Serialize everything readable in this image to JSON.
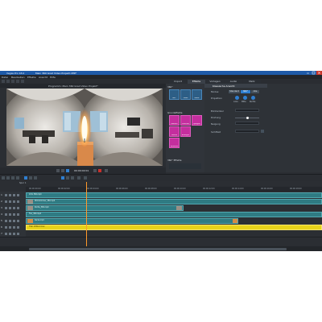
{
  "window": {
    "app_label": "Vegas Pro 18.0",
    "caption": "Mein 360 Grad Video Projekt.VPR*"
  },
  "menubar": {
    "items": [
      "Datei",
      "Bearbeiten",
      "Effekte",
      "Ansicht",
      "Hilfe"
    ]
  },
  "tabs": [
    "Import",
    "Effekte",
    "Vorlagen",
    "Audio",
    "Mehr"
  ],
  "preview": {
    "title": "Programm: Mein 360 Grad Video Projekt*",
    "timecode": "00:00:02:01"
  },
  "effects_panel": {
    "group1": "360°",
    "group2": "Grundeffekte",
    "group3": "360° Effekte",
    "tiles": [
      {
        "label": "360°",
        "color": "#2d5e86"
      },
      {
        "label": "Zoom",
        "color": "#2d5e86"
      },
      {
        "label": "Effekt",
        "color": "#2d5e86"
      },
      {
        "label": "Rahmen",
        "color": "#c42e9e"
      },
      {
        "label": "Zuschnitt",
        "color": "#c42e9e"
      },
      {
        "label": "Spiegeln",
        "color": "#c42e9e"
      },
      {
        "label": "Drehen",
        "color": "#c42e9e"
      },
      {
        "label": "Bewegen",
        "color": "#c42e9e"
      },
      {
        "label": "Verzerren",
        "color": "#c42e9e"
      }
    ]
  },
  "properties": {
    "title": "Klassische Ansicht",
    "rows": [
      {
        "label": "Modus:"
      },
      {
        "label": "Projektion"
      },
      {
        "label": "Blickwinkel"
      },
      {
        "label": "Drehung"
      },
      {
        "label": "Neigung"
      },
      {
        "label": "Sichtfeld"
      }
    ],
    "mode_buttons": [
      "Standard",
      "360°",
      "Alle"
    ],
    "radio_labels": [
      "Links",
      "Mitte",
      "Rechts"
    ]
  },
  "timeline": {
    "toolbar_label": "Spur 1",
    "ruler": [
      "00:00:00:00",
      "00:00:02:00",
      "00:00:04:00",
      "00:00:06:00",
      "00:00:08:00",
      "00:00:10:00",
      "00:00:12:00",
      "00:00:14:00",
      "00:00:16:00",
      "00:00:18:00"
    ],
    "tracks": [
      "1",
      "2",
      "3",
      "4",
      "5",
      "6",
      "7"
    ],
    "clips": [
      {
        "label": "Intro 360.mp4"
      },
      {
        "label": "Wohnzimmer_360.mp4"
      },
      {
        "label": "Küche_360.mp4"
      },
      {
        "label": "Flur_360.mp4"
      },
      {
        "label": "Kerze.mp4"
      },
      {
        "label": "Titel: Willkommen"
      }
    ]
  },
  "colors": {
    "title_bar": "#1e5aa8",
    "accent_blue": "#2f7fd1",
    "effect_tile": "#c42e9e",
    "clip_teal": "#2f7b83",
    "clip_yellow": "#e7d21a",
    "playhead": "#ff9a2a"
  }
}
